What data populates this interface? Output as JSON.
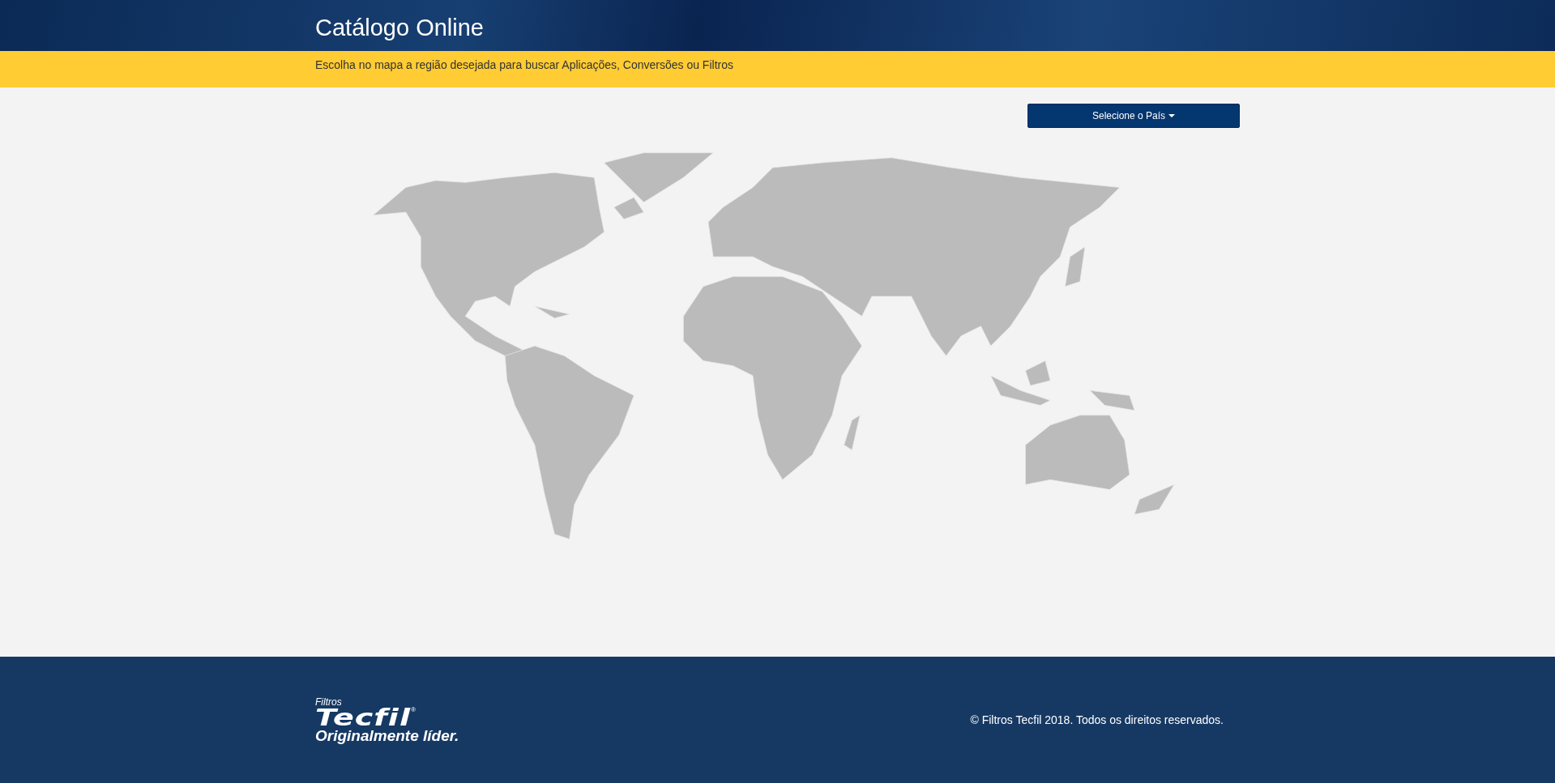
{
  "header": {
    "title": "Catálogo Online"
  },
  "banner": {
    "text": "Escolha no mapa a região desejada para buscar Aplicações, Conversões ou Filtros"
  },
  "country_select": {
    "label": "Selecione o País"
  },
  "footer": {
    "logo": {
      "brand_small": "Filtros",
      "brand": "Tecfil",
      "registered": "®",
      "tagline": "Originalmente líder."
    },
    "copyright": "© Filtros Tecfil 2018. Todos os direitos reservados."
  }
}
